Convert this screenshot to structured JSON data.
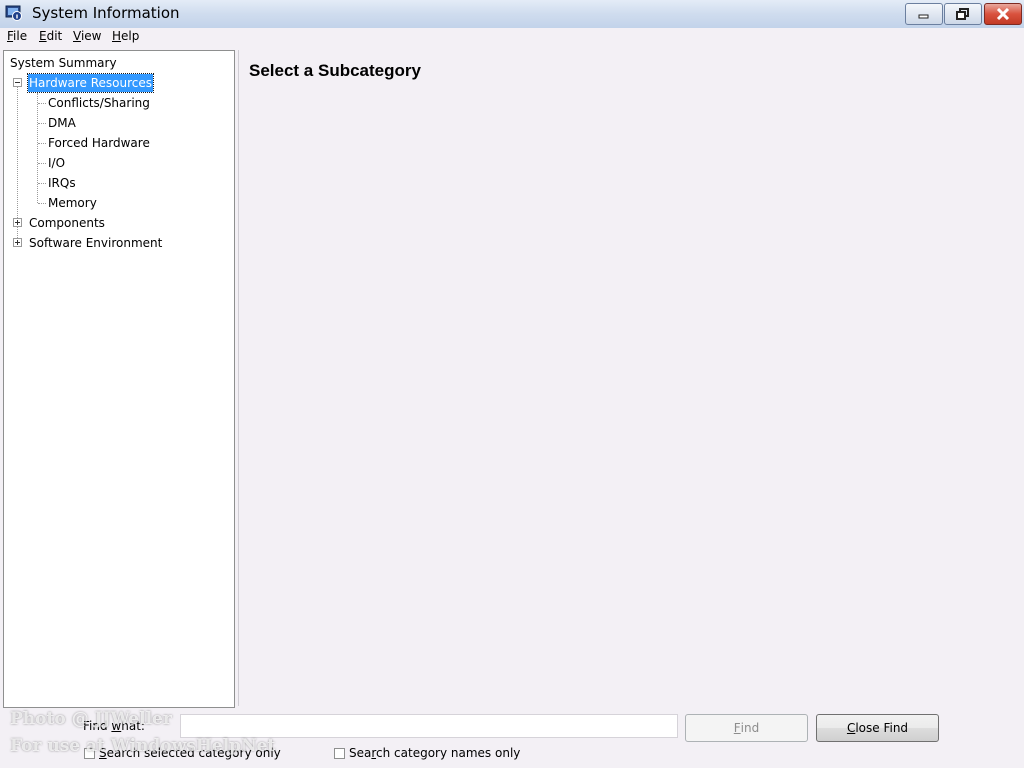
{
  "window": {
    "title": "System Information",
    "app_icon": "system-information-icon"
  },
  "title_buttons": {
    "minimize": "minimize-icon",
    "restore": "restore-icon",
    "close": "close-icon"
  },
  "menu": {
    "items": [
      {
        "label": "File",
        "accel": "F",
        "rest": "ile"
      },
      {
        "label": "Edit",
        "accel": "E",
        "rest": "dit"
      },
      {
        "label": "View",
        "accel": "V",
        "rest": "iew"
      },
      {
        "label": "Help",
        "accel": "H",
        "rest": "elp"
      }
    ]
  },
  "tree": {
    "system_summary": "System Summary",
    "hardware_resources": "Hardware Resources",
    "hardware_children": [
      "Conflicts/Sharing",
      "DMA",
      "Forced Hardware",
      "I/O",
      "IRQs",
      "Memory"
    ],
    "components": "Components",
    "software_environment": "Software Environment"
  },
  "main": {
    "title": "Select a Subcategory"
  },
  "find": {
    "label_pre": "Find ",
    "label_accel": "w",
    "label_post": "hat:",
    "input_value": "",
    "find_button_accel": "F",
    "find_button_rest": "ind",
    "close_button_accel": "C",
    "close_button_rest": "lose Find",
    "checkbox1_accel": "S",
    "checkbox1_rest": "earch selected category only",
    "checkbox2_pre": "Sea",
    "checkbox2_accel": "r",
    "checkbox2_post": "ch category names only"
  },
  "watermark": {
    "line1": "Photo @ JJWeller",
    "line2": "For use at WindowsHelpNet"
  },
  "colors": {
    "selection": "#3399ff",
    "close_button": "#c9432f"
  }
}
